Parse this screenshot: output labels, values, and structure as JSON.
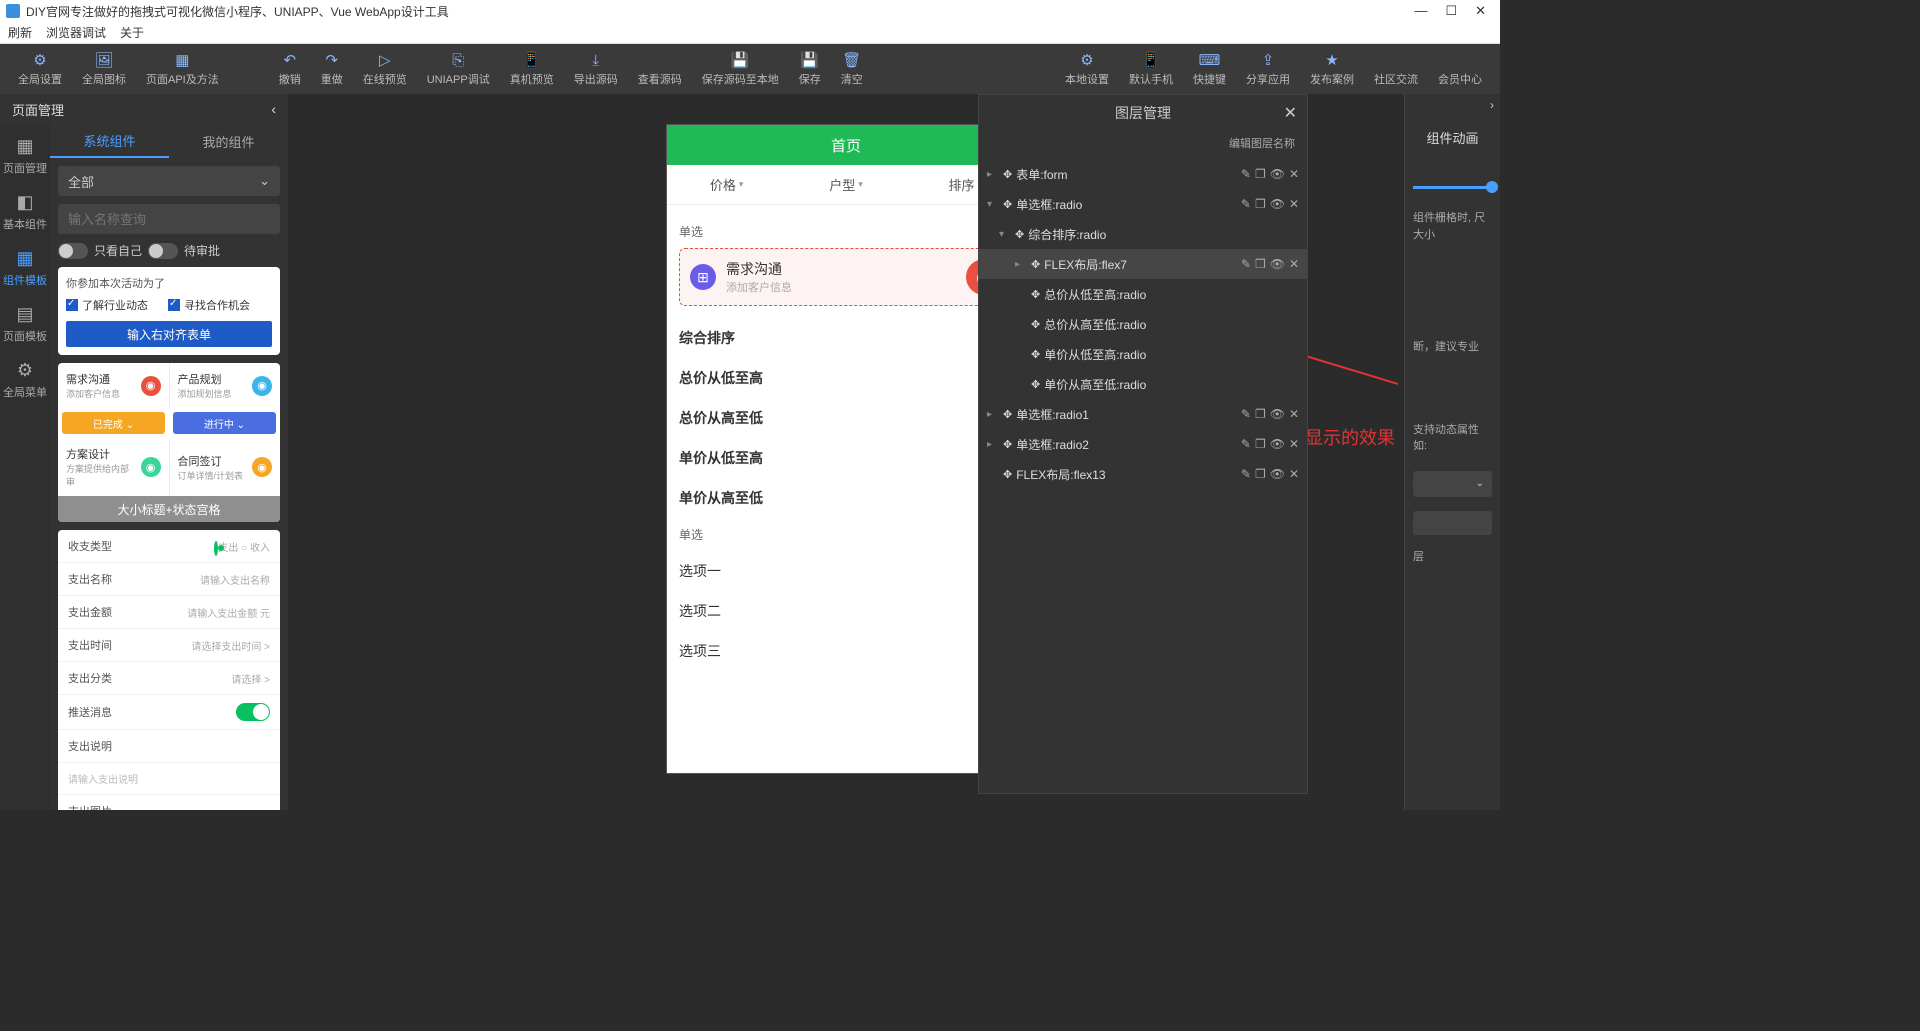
{
  "title": "DIY官网专注做好的拖拽式可视化微信小程序、UNIAPP、Vue WebApp设计工具",
  "winbtns": [
    "—",
    "☐",
    "✕"
  ],
  "menubar": [
    "刷新",
    "浏览器调试",
    "关于"
  ],
  "toolbar_left": [
    {
      "ic": "⚙",
      "l": "全局设置"
    },
    {
      "ic": "🖼",
      "l": "全局图标"
    },
    {
      "ic": "▦",
      "l": "页面API及方法"
    }
  ],
  "toolbar_mid": [
    {
      "ic": "↶",
      "l": "撤销"
    },
    {
      "ic": "↷",
      "l": "重做"
    },
    {
      "ic": "▷",
      "l": "在线预览"
    },
    {
      "ic": "⎘",
      "l": "UNIAPP调试"
    },
    {
      "ic": "📱",
      "l": "真机预览"
    },
    {
      "ic": "⤓",
      "l": "导出源码"
    },
    {
      "ic": "</>",
      "l": "查看源码"
    },
    {
      "ic": "💾",
      "l": "保存源码至本地"
    },
    {
      "ic": "💾",
      "l": "保存"
    },
    {
      "ic": "🗑",
      "l": "清空"
    }
  ],
  "toolbar_right": [
    {
      "ic": "⚙",
      "l": "本地设置"
    },
    {
      "ic": "📱",
      "l": "默认手机"
    },
    {
      "ic": "⌨",
      "l": "快捷键"
    },
    {
      "ic": "⇪",
      "l": "分享应用"
    },
    {
      "ic": "★",
      "l": "发布案例"
    },
    {
      "ic": "",
      "l": "社区交流"
    },
    {
      "ic": "",
      "l": "会员中心"
    }
  ],
  "leftTitle": "页面管理",
  "leftbar": [
    {
      "ic": "▦",
      "l": "页面管理"
    },
    {
      "ic": "◧",
      "l": "基本组件"
    },
    {
      "ic": "▦",
      "l": "组件模板",
      "active": true
    },
    {
      "ic": "▤",
      "l": "页面模板"
    },
    {
      "ic": "⚙",
      "l": "全局菜单"
    }
  ],
  "lpTabs": [
    "系统组件",
    "我的组件"
  ],
  "lpSelect": "全部",
  "lpSearchPh": "输入名称查询",
  "lpTog1": "只看自己",
  "lpTog2": "待审批",
  "card1": {
    "hdr": "你参加本次活动为了",
    "c1": "了解行业动态",
    "c2": "寻找合作机会",
    "btn": "输入右对齐表单"
  },
  "card2": {
    "r1": [
      {
        "t1": "需求沟通",
        "t2": "添加客户信息",
        "c": "#e8513f"
      },
      {
        "t1": "产品规划",
        "t2": "添加规划信息",
        "c": "#3bb4e8"
      }
    ],
    "r2": [
      {
        "l": "已完成",
        "c": "#f5a623"
      },
      {
        "l": "进行中",
        "c": "#4a6ee0"
      }
    ],
    "r3": [
      {
        "t1": "方案设计",
        "t2": "方案提供给内部审",
        "c": "#3bd49a"
      },
      {
        "t1": "合同签订",
        "t2": "订单详情/计划表",
        "c": "#f5a623"
      }
    ],
    "ft": "大小标题+状态宫格"
  },
  "card3": {
    "rows": [
      {
        "l": "收支类型",
        "v": "支出 ○ 收入",
        "rad": true
      },
      {
        "l": "支出名称",
        "v": "请输入支出名称"
      },
      {
        "l": "支出金额",
        "v": "请输入支出金额 元"
      },
      {
        "l": "支出时间",
        "v": "请选择支出时间 >"
      },
      {
        "l": "支出分类",
        "v": "请选择 >"
      },
      {
        "l": "推送消息",
        "sw": true
      },
      {
        "l": "支出说明",
        "v": ""
      },
      {
        "l": "请输入支出说明",
        "ph": true
      },
      {
        "l": "支出图片",
        "v": ""
      }
    ]
  },
  "phone": {
    "title": "首页",
    "tabs": [
      "价格",
      "户型",
      "排序"
    ],
    "sec1": "单选",
    "demand": {
      "t1": "需求沟通",
      "t2": "添加客户信息"
    },
    "sorts": [
      "综合排序",
      "总价从低至高",
      "总价从高至低",
      "单价从低至高",
      "单价从高至低"
    ],
    "sec2": "单选",
    "opts": [
      "选项一",
      "选项二",
      "选项三"
    ]
  },
  "annot": "拖动以后显示的效果",
  "layer": {
    "title": "图层管理",
    "sub": "编辑图层名称",
    "rows": [
      {
        "p": 0,
        "ex": "▸",
        "nm": "表单:form",
        "a": true
      },
      {
        "p": 0,
        "ex": "▾",
        "nm": "单选框:radio",
        "a": true
      },
      {
        "p": 1,
        "ex": "▾",
        "nm": "综合排序:radio"
      },
      {
        "p": 2,
        "ex": "▸",
        "nm": "FLEX布局:flex7",
        "a": true,
        "sel": true
      },
      {
        "p": 2,
        "ex": "",
        "nm": "总价从低至高:radio"
      },
      {
        "p": 2,
        "ex": "",
        "nm": "总价从高至低:radio"
      },
      {
        "p": 2,
        "ex": "",
        "nm": "单价从低至高:radio"
      },
      {
        "p": 2,
        "ex": "",
        "nm": "单价从高至低:radio"
      },
      {
        "p": 0,
        "ex": "▸",
        "nm": "单选框:radio1",
        "a": true
      },
      {
        "p": 0,
        "ex": "▸",
        "nm": "单选框:radio2",
        "a": true
      },
      {
        "p": 0,
        "ex": "",
        "nm": "FLEX布局:flex13",
        "a": true
      }
    ]
  },
  "right": {
    "tab": "组件动画",
    "t1": "组件栅格时,\n尺大小",
    "t2": "断，建议专业",
    "t3": "支持动态属性如:",
    "t4": "层"
  }
}
